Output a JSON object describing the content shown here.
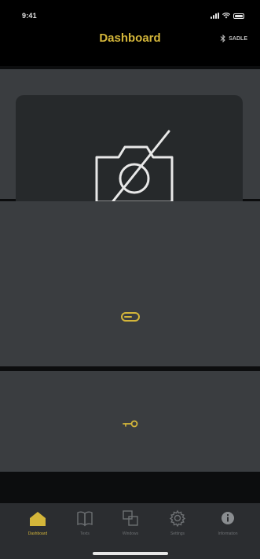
{
  "status_bar": {
    "time": "9:41"
  },
  "nav": {
    "title": "Dashboard",
    "device_label": "SADLE"
  },
  "tabs": [
    {
      "label": "Dashboard",
      "icon": "home-icon",
      "active": true
    },
    {
      "label": "Texts",
      "icon": "book-icon",
      "active": false
    },
    {
      "label": "Windows",
      "icon": "windows-icon",
      "active": false
    },
    {
      "label": "Settings",
      "icon": "gear-icon",
      "active": false
    },
    {
      "label": "Information",
      "icon": "info-icon",
      "active": false
    }
  ],
  "colors": {
    "accent": "#d4b63a",
    "background": "#0c0d0e",
    "panel": "#3a3d40",
    "panel_inner": "#26292b",
    "tab_bar": "#2b2d30",
    "inactive": "#6d7073"
  }
}
